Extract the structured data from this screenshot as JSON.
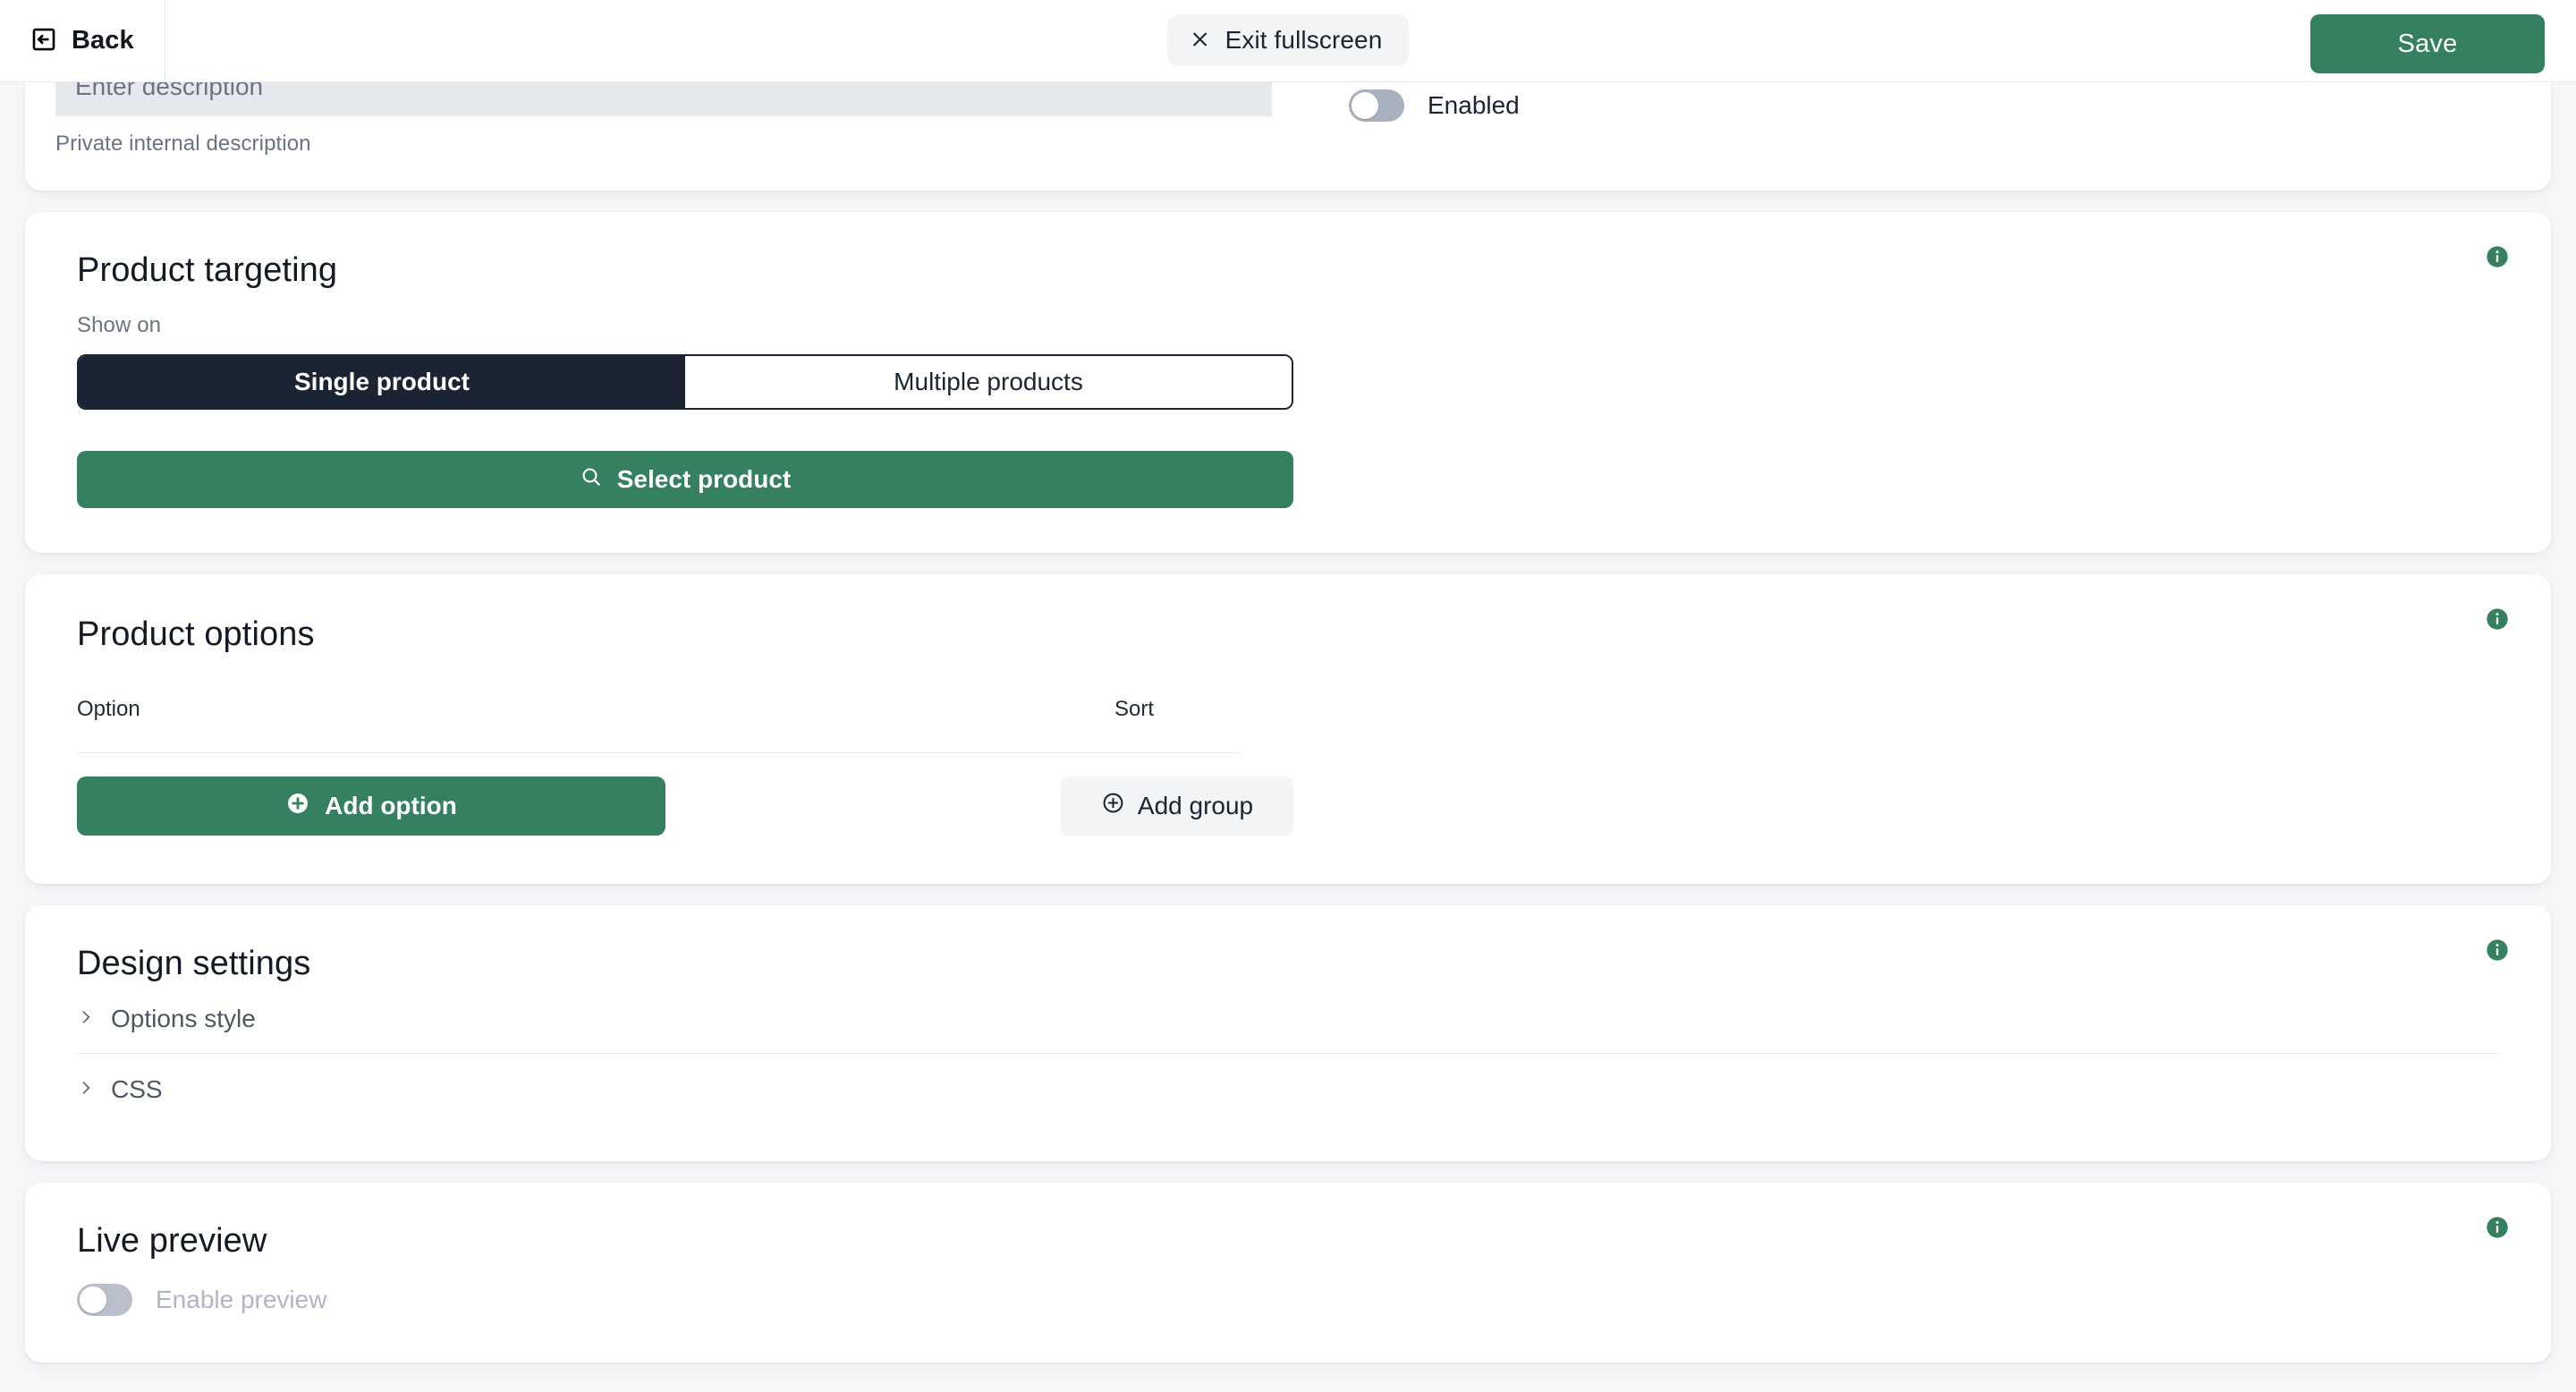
{
  "topbar": {
    "back_label": "Back",
    "back_icon": "arrow-left-square-icon",
    "exit_fullscreen_label": "Exit fullscreen",
    "exit_fullscreen_icon": "close-x-icon",
    "save_label": "Save"
  },
  "colors": {
    "accent_green": "#35805E",
    "dark_navy": "#1B2433",
    "page_background": "#F6F7F9",
    "card_background": "#FFFFFF",
    "input_background": "#E5E9ED",
    "muted_text": "#6A7383",
    "toggle_off_track": "#A9B1BE"
  },
  "description_section": {
    "input_placeholder": "Enter description",
    "input_value": "",
    "help_text": "Private internal description",
    "enabled_label": "Enabled",
    "enabled_state": "off"
  },
  "product_targeting": {
    "title": "Product targeting",
    "info_icon": "info-circle-icon",
    "show_on_label": "Show on",
    "segments": [
      {
        "label": "Single product",
        "selected": true
      },
      {
        "label": "Multiple products",
        "selected": false
      }
    ],
    "select_product_label": "Select product",
    "select_product_icon": "search-icon"
  },
  "product_options": {
    "title": "Product options",
    "info_icon": "info-circle-icon",
    "columns": [
      "Option",
      "Sort"
    ],
    "rows": [],
    "add_option_label": "Add option",
    "add_option_icon": "plus-circle-filled-icon",
    "add_group_label": "Add group",
    "add_group_icon": "plus-circle-outline-icon"
  },
  "design_settings": {
    "title": "Design settings",
    "info_icon": "info-circle-icon",
    "accordions": [
      {
        "label": "Options style",
        "expanded": false,
        "icon": "chevron-right-icon"
      },
      {
        "label": "CSS",
        "expanded": false,
        "icon": "chevron-right-icon"
      }
    ]
  },
  "live_preview": {
    "title": "Live preview",
    "info_icon": "info-circle-icon",
    "enable_preview_label": "Enable preview",
    "enable_preview_state": "off"
  }
}
